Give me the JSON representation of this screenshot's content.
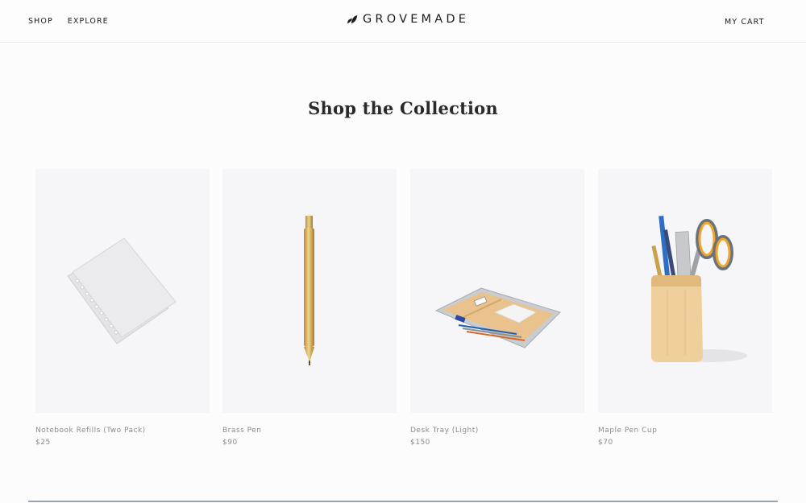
{
  "nav": {
    "shop": "SHOP",
    "explore": "EXPLORE",
    "brand": "GROVEMADE",
    "cart": "MY CART"
  },
  "section": {
    "title": "Shop the Collection"
  },
  "products": [
    {
      "name": "Notebook Refills (Two Pack)",
      "price": "$25",
      "icon": "notebook-image"
    },
    {
      "name": "Brass Pen",
      "price": "$90",
      "icon": "brass-pen-image"
    },
    {
      "name": "Desk Tray (Light)",
      "price": "$150",
      "icon": "desk-tray-image"
    },
    {
      "name": "Maple Pen Cup",
      "price": "$70",
      "icon": "pen-cup-image"
    }
  ],
  "colors": {
    "text": "#1c1c1c",
    "muted": "#8b8b8f",
    "card_bg": "#f6f5f7",
    "footer_rule": "#9aa2ad"
  }
}
